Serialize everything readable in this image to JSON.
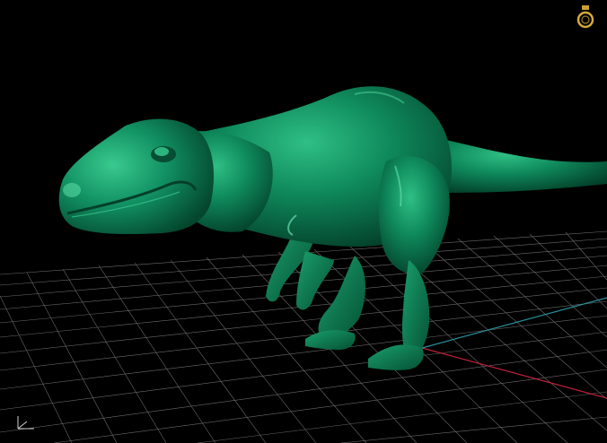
{
  "viewport": {
    "background": "#000000",
    "model": "t-rex sculpt",
    "model_color": "#0f7f55",
    "grid_color": "#8a8a8a",
    "x_axis_color": "#c0203c",
    "y_axis_color": "#2a8f9a"
  },
  "icons": {
    "logo": "ring-logo-icon",
    "axis_gizmo": "axis-gizmo-icon"
  }
}
